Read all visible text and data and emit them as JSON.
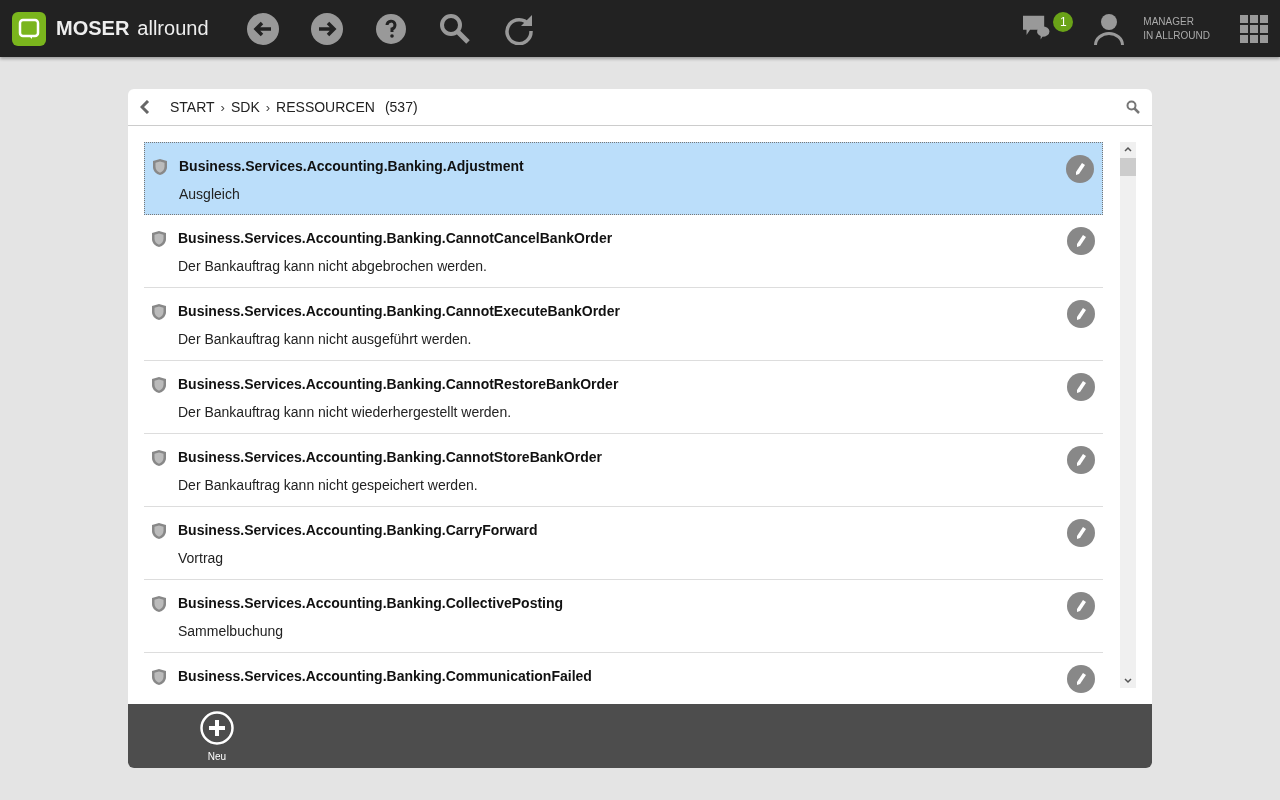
{
  "app": {
    "brand": "MOSER",
    "product": "allround",
    "notifications": "1",
    "user": [
      "MANAGER",
      "IN ALLROUND"
    ]
  },
  "breadcrumb": {
    "items": [
      "START",
      "SDK",
      "RESSOURCEN"
    ],
    "separator": "›",
    "count": "(537)"
  },
  "rows": [
    {
      "title": "Business.Services.Accounting.Banking.Adjustment",
      "text": "Ausgleich",
      "selected": true
    },
    {
      "title": "Business.Services.Accounting.Banking.CannotCancelBankOrder",
      "text": "Der Bankauftrag kann nicht abgebrochen werden.",
      "selected": false
    },
    {
      "title": "Business.Services.Accounting.Banking.CannotExecuteBankOrder",
      "text": "Der Bankauftrag kann nicht ausgeführt werden.",
      "selected": false
    },
    {
      "title": "Business.Services.Accounting.Banking.CannotRestoreBankOrder",
      "text": "Der Bankauftrag kann nicht wiederhergestellt werden.",
      "selected": false
    },
    {
      "title": "Business.Services.Accounting.Banking.CannotStoreBankOrder",
      "text": "Der Bankauftrag kann nicht gespeichert werden.",
      "selected": false
    },
    {
      "title": "Business.Services.Accounting.Banking.CarryForward",
      "text": "Vortrag",
      "selected": false
    },
    {
      "title": "Business.Services.Accounting.Banking.CollectivePosting",
      "text": "Sammelbuchung",
      "selected": false
    },
    {
      "title": "Business.Services.Accounting.Banking.CommunicationFailed",
      "selected": false
    }
  ],
  "footer": {
    "new_label": "Neu"
  }
}
